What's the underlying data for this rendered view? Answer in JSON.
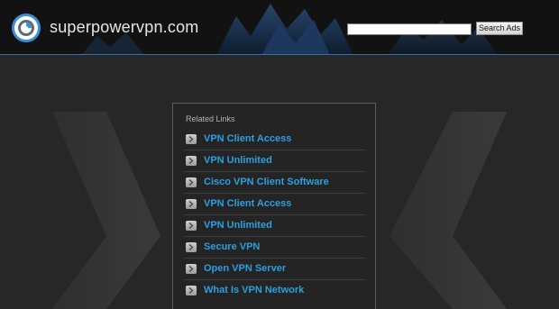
{
  "header": {
    "site_title": "superpowervpn.com",
    "logo_icon": "power-swirl-logo-icon",
    "search_placeholder": "",
    "search_value": "",
    "search_button_label": "Search Ads"
  },
  "related_links": {
    "title": "Related Links",
    "arrow_icon": "chevron-right-icon",
    "items": [
      {
        "label": "VPN Client Access"
      },
      {
        "label": "VPN Unlimited"
      },
      {
        "label": "Cisco VPN Client Software"
      },
      {
        "label": "VPN Client Access"
      },
      {
        "label": "VPN Unlimited"
      },
      {
        "label": "Secure VPN"
      },
      {
        "label": "Open VPN Server"
      },
      {
        "label": "What Is VPN Network"
      }
    ]
  },
  "colors": {
    "background": "#272727",
    "header_background": "#141414",
    "accent_line": "#3a6ea8",
    "link": "#2b9fe0",
    "panel_border": "#5c5c5c"
  }
}
